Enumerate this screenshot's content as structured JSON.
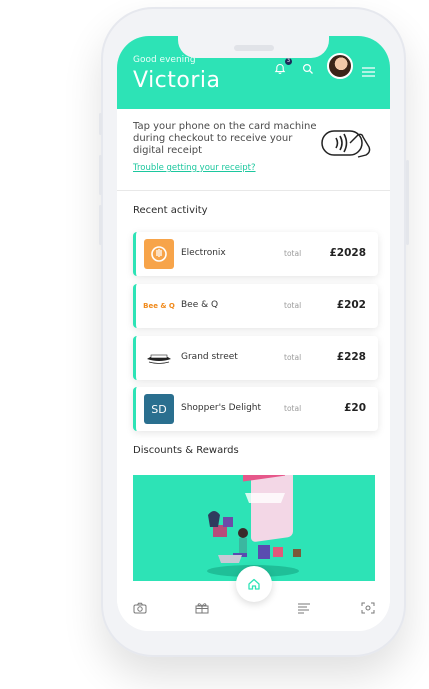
{
  "header": {
    "greeting": "Good evening",
    "name": "Victoria",
    "notification_count": "3"
  },
  "receipt_prompt": {
    "text": "Tap your phone on the card machine during checkout to receive your digital receipt",
    "link": "Trouble getting your receipt?"
  },
  "recent_activity": {
    "title": "Recent activity",
    "items": [
      {
        "merchant": "Electronix",
        "total_label": "total",
        "amount": "£2028",
        "logo": "electronix-logo"
      },
      {
        "merchant": "Bee & Q",
        "total_label": "total",
        "amount": "£202",
        "logo_text": "Bee & Q"
      },
      {
        "merchant": "Grand street",
        "total_label": "total",
        "amount": "£228",
        "logo": "grand-street-logo"
      },
      {
        "merchant": "Shopper's Delight",
        "total_label": "total",
        "amount": "£20",
        "logo_text": "SD"
      }
    ]
  },
  "discounts": {
    "title": "Discounts & Rewards"
  },
  "colors": {
    "accent": "#2de3b6",
    "electronix": "#f7a44a",
    "bee_q": "#f08a1c",
    "sd": "#2a6f8f"
  },
  "icons": [
    "bell-icon",
    "search-icon",
    "menu-icon",
    "nfc-tap-icon",
    "camera-icon",
    "gift-icon",
    "home-icon",
    "list-icon",
    "scan-icon"
  ]
}
